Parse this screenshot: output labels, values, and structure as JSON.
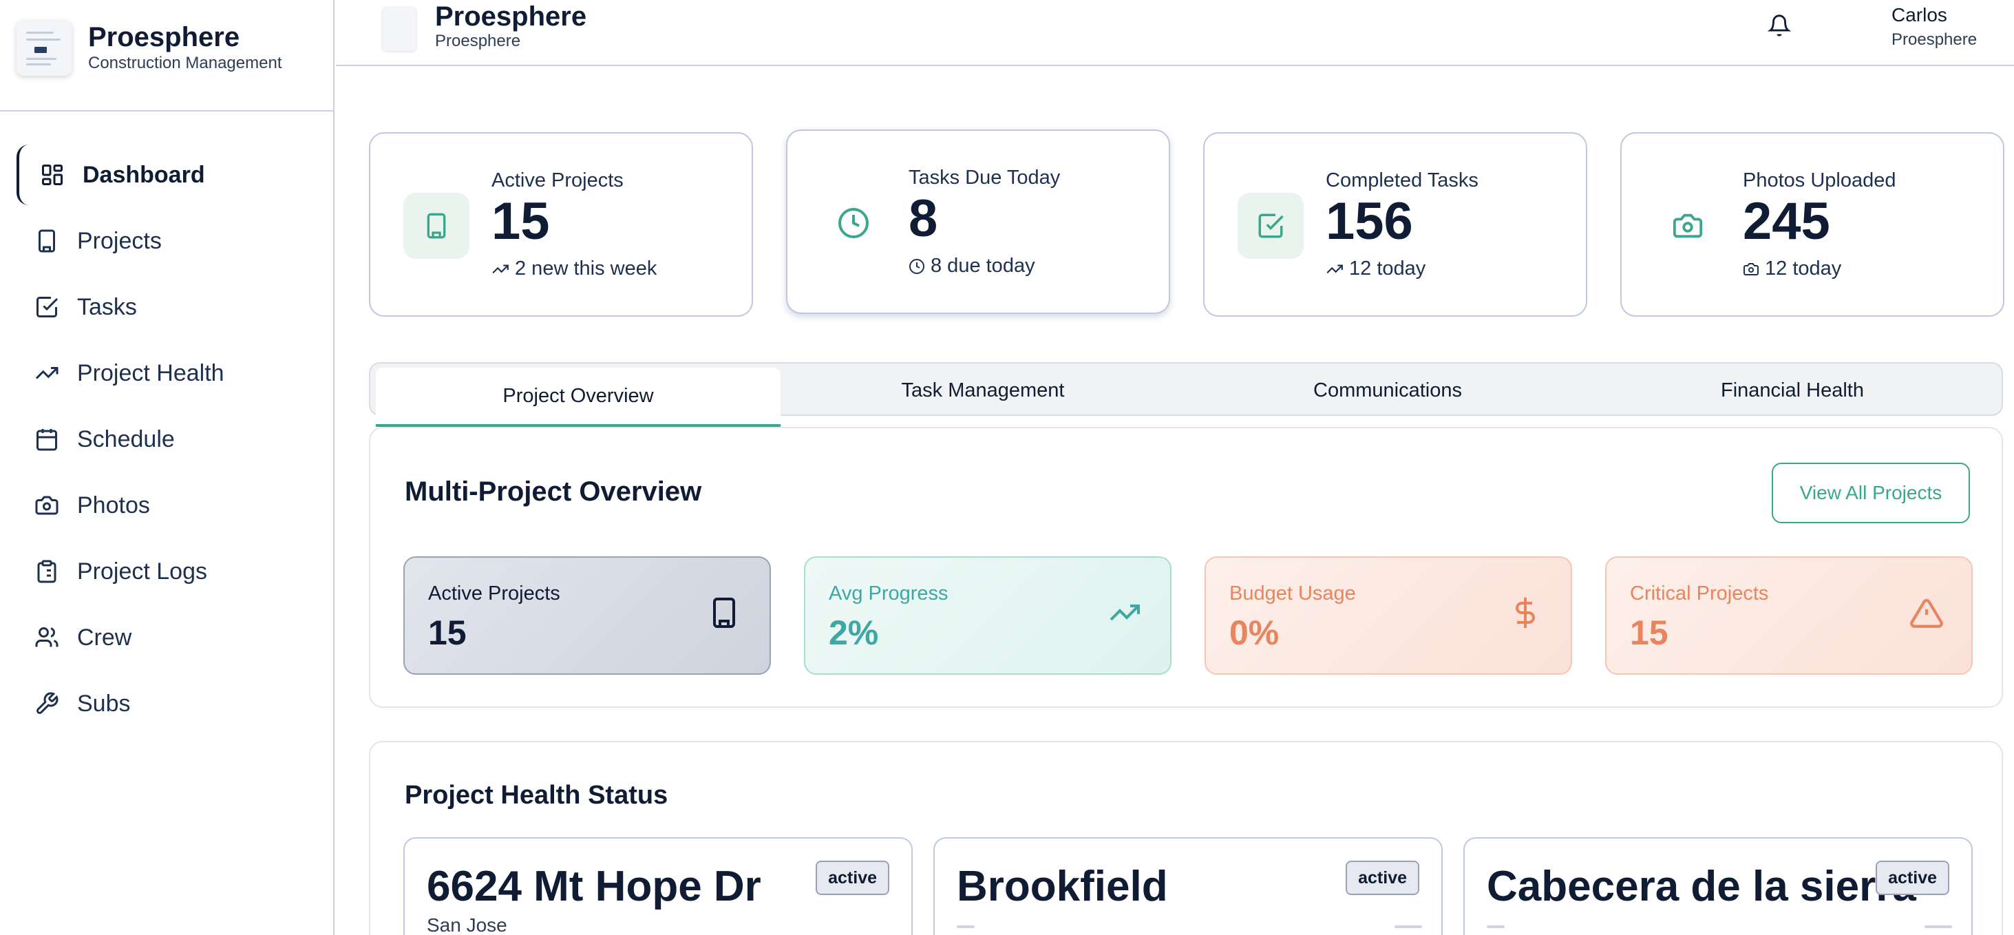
{
  "brand": {
    "name": "Proesphere",
    "subtitle": "Construction Management"
  },
  "header": {
    "title": "Proesphere",
    "subtitle": "Proesphere",
    "user_name": "Carlos",
    "user_org": "Proesphere"
  },
  "sidebar": {
    "items": [
      {
        "label": "Dashboard",
        "icon": "dashboard-icon",
        "active": true
      },
      {
        "label": "Projects",
        "icon": "building-icon"
      },
      {
        "label": "Tasks",
        "icon": "check-square-icon"
      },
      {
        "label": "Project Health",
        "icon": "trending-up-icon"
      },
      {
        "label": "Schedule",
        "icon": "calendar-icon"
      },
      {
        "label": "Photos",
        "icon": "camera-icon"
      },
      {
        "label": "Project Logs",
        "icon": "clipboard-icon"
      },
      {
        "label": "Crew",
        "icon": "users-icon"
      },
      {
        "label": "Subs",
        "icon": "wrench-icon"
      }
    ]
  },
  "stats": [
    {
      "label": "Active Projects",
      "value": "15",
      "sub": "2 new this week",
      "icon": "building-icon",
      "sub_icon": "trending-up-icon"
    },
    {
      "label": "Tasks Due Today",
      "value": "8",
      "sub": "8 due today",
      "icon": "clock-icon",
      "sub_icon": "clock-icon"
    },
    {
      "label": "Completed Tasks",
      "value": "156",
      "sub": "12 today",
      "icon": "check-square-icon",
      "sub_icon": "trending-up-icon"
    },
    {
      "label": "Photos Uploaded",
      "value": "245",
      "sub": "12 today",
      "icon": "camera-icon",
      "sub_icon": "camera-icon"
    }
  ],
  "tabs": [
    {
      "label": "Project Overview",
      "active": true
    },
    {
      "label": "Task Management"
    },
    {
      "label": "Communications"
    },
    {
      "label": "Financial Health"
    }
  ],
  "overview": {
    "title": "Multi-Project Overview",
    "view_all_label": "View All Projects",
    "cards": [
      {
        "label": "Active Projects",
        "value": "15",
        "icon": "building-icon"
      },
      {
        "label": "Avg Progress",
        "value": "2%",
        "icon": "trending-up-icon"
      },
      {
        "label": "Budget Usage",
        "value": "0%",
        "icon": "dollar-icon"
      },
      {
        "label": "Critical Projects",
        "value": "15",
        "icon": "alert-triangle-icon"
      }
    ]
  },
  "health": {
    "title": "Project Health Status",
    "projects": [
      {
        "name": "6624 Mt Hope Dr",
        "city": "San Jose",
        "status": "active"
      },
      {
        "name": "Brookfield",
        "city": "",
        "status": "active"
      },
      {
        "name": "Cabecera de la sierra",
        "city": "",
        "status": "active"
      }
    ]
  },
  "colors": {
    "accent": "#3aa68b",
    "text": "#0f1c33",
    "border": "#bfc7e3",
    "warning": "#e8845e",
    "teal": "#3fa7a3"
  }
}
